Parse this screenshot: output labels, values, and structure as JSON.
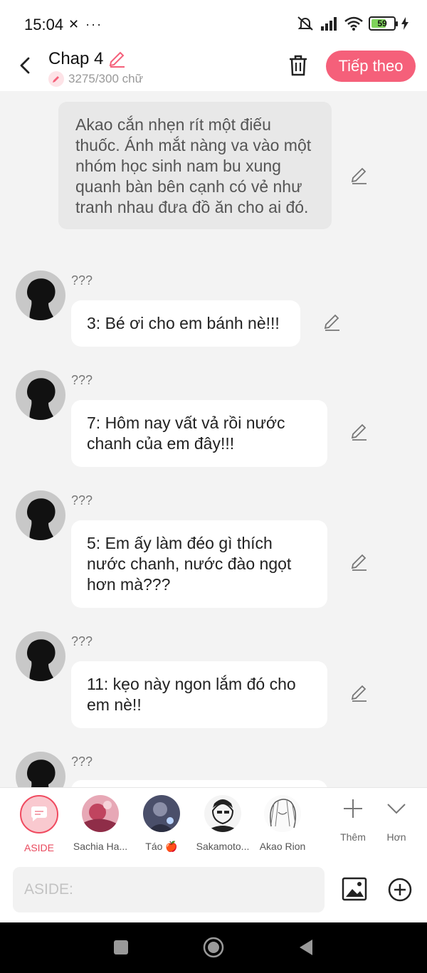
{
  "status_bar": {
    "time": "15:04",
    "left_icons": "✕ ···",
    "battery": "59"
  },
  "header": {
    "title": "Chap 4",
    "word_count": "3275/300 chữ",
    "next_button": "Tiếp theo"
  },
  "narration": {
    "text": "Akao cắn nhẹn rít một điếu thuốc. Ánh mắt nàng va vào một nhóm học sinh nam bu xung quanh bàn bên cạnh có vẻ như tranh nhau đưa đồ ăn cho ai đó."
  },
  "messages": [
    {
      "name": "???",
      "text": "3: Bé ơi cho em bánh nè!!!"
    },
    {
      "name": "???",
      "text": "7: Hôm nay vất vả rồi nước chanh của em đây!!!"
    },
    {
      "name": "???",
      "text": "5: Em ấy làm đéo gì thích nước chanh, nước đào ngọt hơn mà???"
    },
    {
      "name": "???",
      "text": "11: kẹo này ngon lắm đó cho em nè!!"
    },
    {
      "name": "???"
    }
  ],
  "characters": [
    {
      "label": "ASIDE"
    },
    {
      "label": "Sachia Ha..."
    },
    {
      "label": "Táo 🍎"
    },
    {
      "label": "Sakamoto..."
    },
    {
      "label": "Akao Rion"
    }
  ],
  "tools": {
    "add": "Thêm",
    "more": "Hơn"
  },
  "composer": {
    "placeholder": "ASIDE:"
  },
  "colors": {
    "accent": "#f5607a",
    "aside": "#e94a5e"
  }
}
